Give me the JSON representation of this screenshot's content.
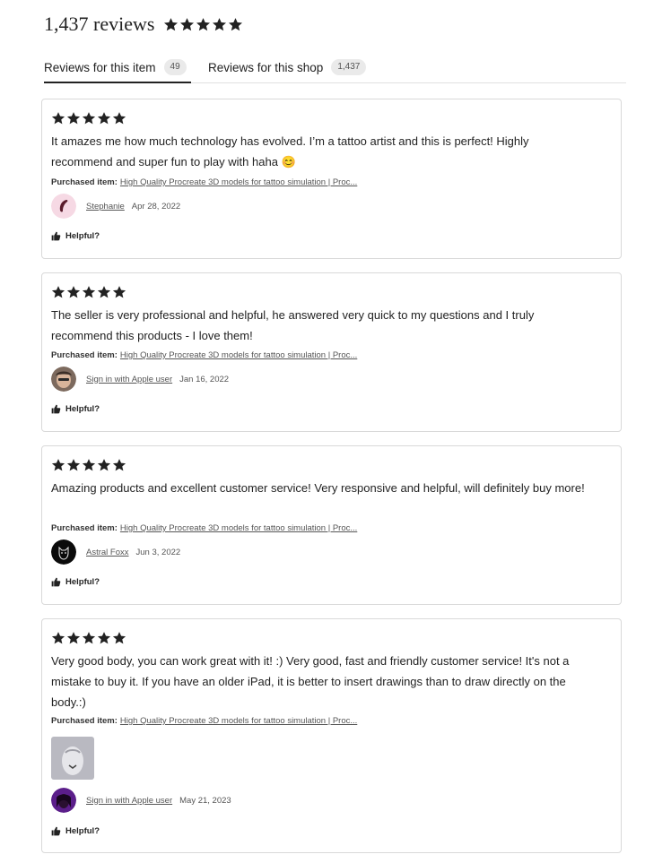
{
  "header": {
    "review_count": "1,437 reviews",
    "rating": 5
  },
  "tabs": [
    {
      "label": "Reviews for this item",
      "count": "49",
      "active": true
    },
    {
      "label": "Reviews for this shop",
      "count": "1,437",
      "active": false
    }
  ],
  "purchased_label": "Purchased item:",
  "helpful_label": "Helpful?",
  "reviews": [
    {
      "rating": 5,
      "text": "It amazes me how much technology has evolved. I’m a tattoo artist and this is perfect! Highly recommend and super fun to play with haha 😊",
      "item": "High Quality Procreate 3D models for tattoo simulation | Proc...",
      "reviewer": "Stephanie",
      "date": "Apr 28, 2022"
    },
    {
      "rating": 5,
      "text": "The seller is very professional and helpful, he answered very quick to my questions and I truly recommend this products - I love them!",
      "item": "High Quality Procreate 3D models for tattoo simulation | Proc...",
      "reviewer": "Sign in with Apple user",
      "date": "Jan 16, 2022"
    },
    {
      "rating": 5,
      "text": "Amazing products and excellent customer service! Very responsive and helpful, will definitely buy more!",
      "item": "High Quality Procreate 3D models for tattoo simulation | Proc...",
      "reviewer": "Astral Foxx",
      "date": "Jun 3, 2022"
    },
    {
      "rating": 5,
      "text": "Very good body, you can work great with it! :) Very good, fast and friendly customer service! It's not a mistake to buy it. If you have an older iPad, it is better to insert drawings than to draw directly on the body.:)",
      "item": "High Quality Procreate 3D models for tattoo simulation | Proc...",
      "reviewer": "Sign in with Apple user",
      "date": "May 21, 2023"
    }
  ],
  "icons": {
    "star": "star-icon",
    "helpful": "thumbs-up-icon"
  },
  "colors": {
    "star": "#222222",
    "pill_bg": "#eaeaea",
    "border": "#d9d9d9"
  }
}
